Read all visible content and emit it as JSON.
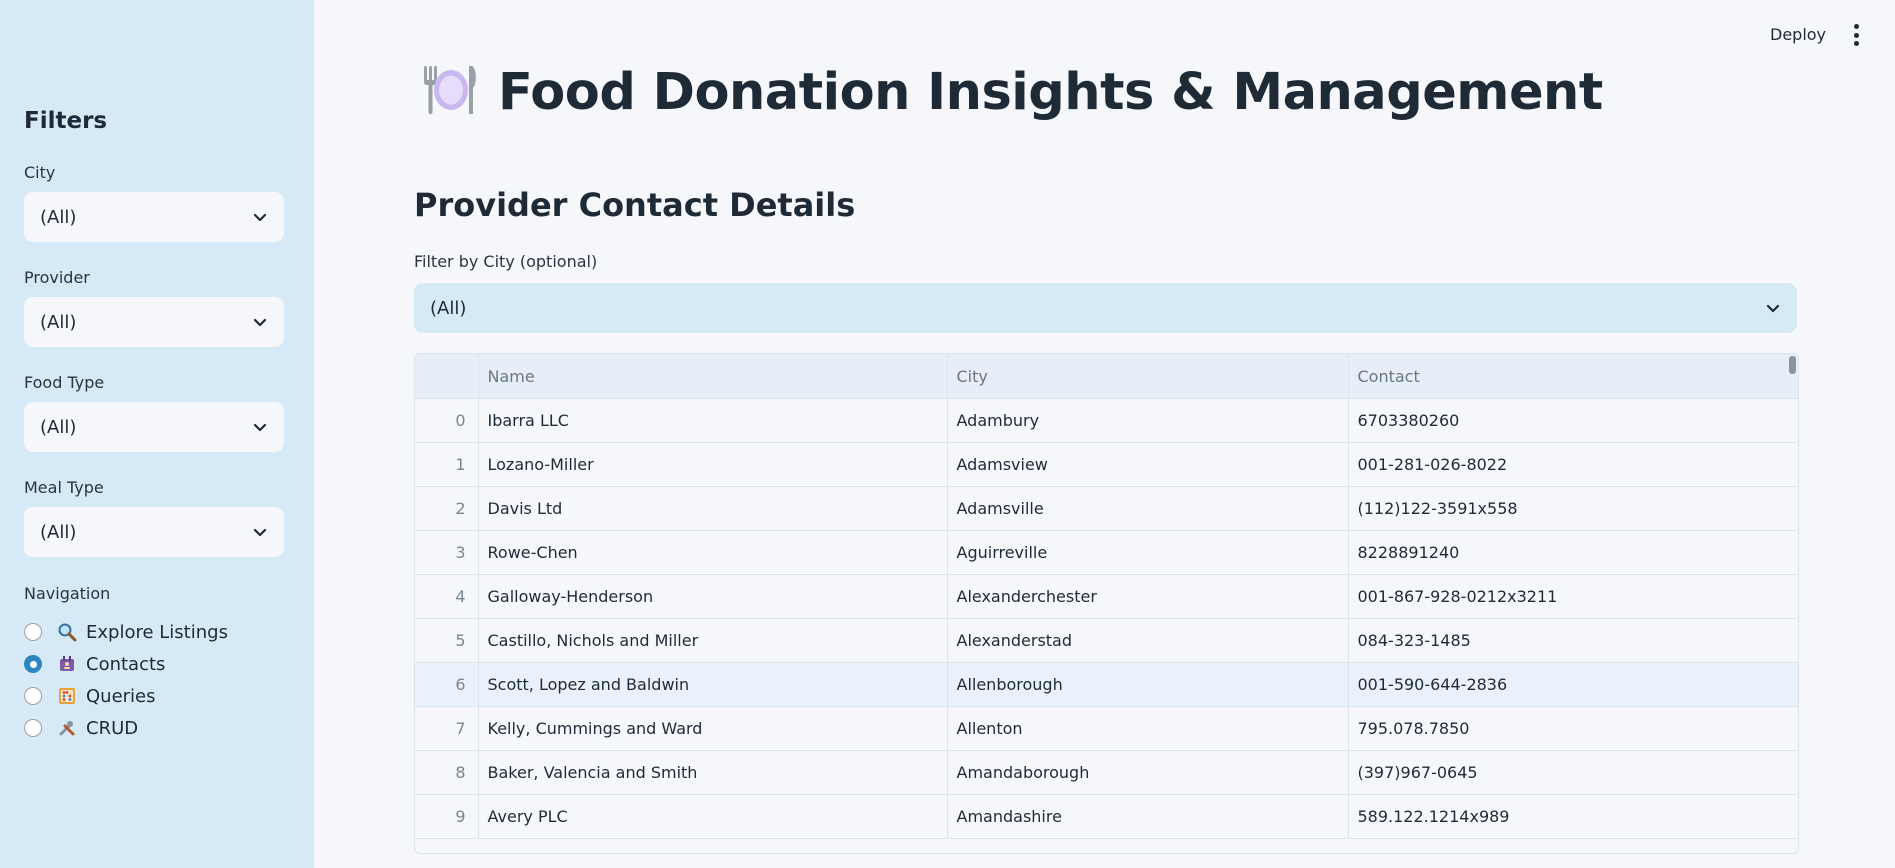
{
  "sidebar": {
    "title": "Filters",
    "filters": [
      {
        "label": "City",
        "value": "(All)"
      },
      {
        "label": "Provider",
        "value": "(All)"
      },
      {
        "label": "Food Type",
        "value": "(All)"
      },
      {
        "label": "Meal Type",
        "value": "(All)"
      }
    ],
    "nav_title": "Navigation",
    "nav": [
      {
        "label": "Explore Listings",
        "icon": "magnifier-icon",
        "checked": false
      },
      {
        "label": "Contacts",
        "icon": "contacts-icon",
        "checked": true
      },
      {
        "label": "Queries",
        "icon": "abacus-icon",
        "checked": false
      },
      {
        "label": "CRUD",
        "icon": "tools-icon",
        "checked": false
      }
    ]
  },
  "header": {
    "deploy_label": "Deploy"
  },
  "main": {
    "title": "Food Donation Insights & Management",
    "title_icon": "plate-cutlery-icon",
    "subtitle": "Provider Contact Details",
    "filter_label": "Filter by City (optional)",
    "filter_value": "(All)",
    "table": {
      "columns": [
        "",
        "Name",
        "City",
        "Contact"
      ],
      "rows": [
        [
          "0",
          "Ibarra LLC",
          "Adambury",
          "6703380260"
        ],
        [
          "1",
          "Lozano-Miller",
          "Adamsview",
          "001-281-026-8022"
        ],
        [
          "2",
          "Davis Ltd",
          "Adamsville",
          "(112)122-3591x558"
        ],
        [
          "3",
          "Rowe-Chen",
          "Aguirreville",
          "8228891240"
        ],
        [
          "4",
          "Galloway-Henderson",
          "Alexanderchester",
          "001-867-928-0212x3211"
        ],
        [
          "5",
          "Castillo, Nichols and Miller",
          "Alexanderstad",
          "084-323-1485"
        ],
        [
          "6",
          "Scott, Lopez and Baldwin",
          "Allenborough",
          "001-590-644-2836"
        ],
        [
          "7",
          "Kelly, Cummings and Ward",
          "Allenton",
          "795.078.7850"
        ],
        [
          "8",
          "Baker, Valencia and Smith",
          "Amandaborough",
          "(397)967-0645"
        ],
        [
          "9",
          "Avery PLC",
          "Amandashire",
          "589.122.1214x989"
        ]
      ]
    }
  },
  "colors": {
    "sidebar_bg": "#d6e9f6",
    "page_bg": "#f5f7fa",
    "accent": "#2e86c1"
  }
}
